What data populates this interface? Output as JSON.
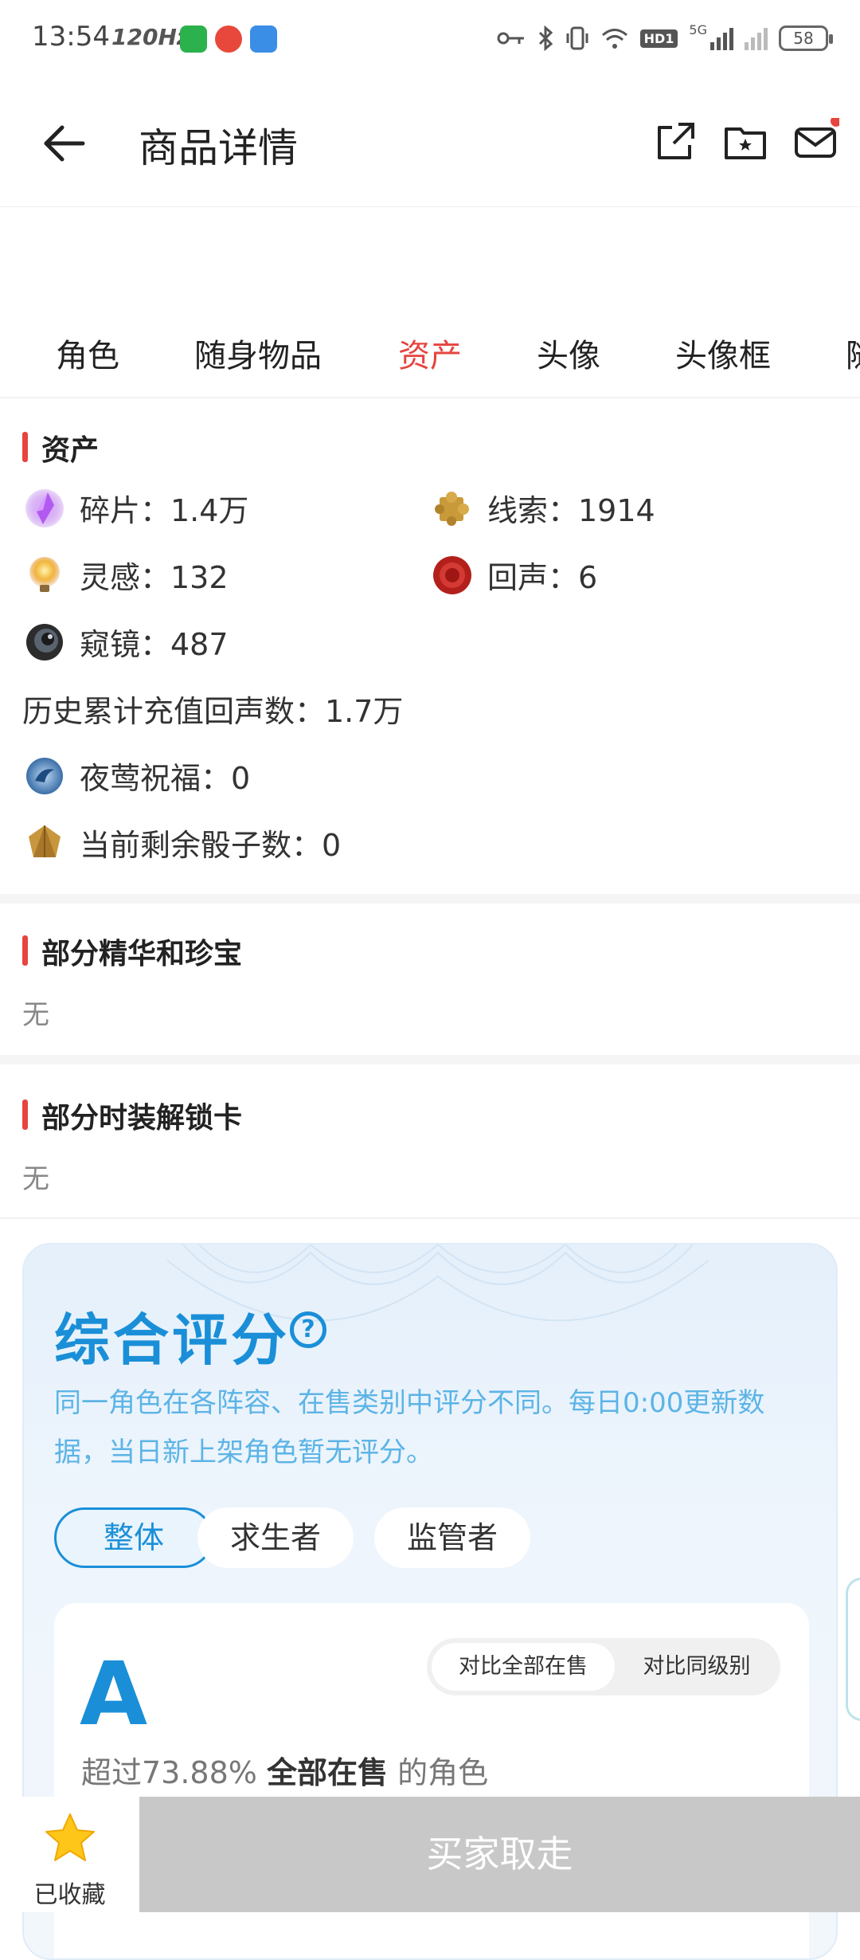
{
  "status_bar": {
    "time": "13:54",
    "refresh_rate": "120Hz",
    "network": "5G",
    "hd_label": "HD1",
    "battery": "58"
  },
  "header": {
    "title": "商品详情"
  },
  "tabs": [
    {
      "label": "角色",
      "active": false
    },
    {
      "label": "随身物品",
      "active": false
    },
    {
      "label": "资产",
      "active": true
    },
    {
      "label": "头像",
      "active": false
    },
    {
      "label": "头像框",
      "active": false
    },
    {
      "label": "随",
      "active": false
    }
  ],
  "assets": {
    "section_title": "资产",
    "items": [
      {
        "label": "碎片：1.4万",
        "icon": "fragment-icon"
      },
      {
        "label": "线索：1914",
        "icon": "clue-icon"
      },
      {
        "label": "灵感：132",
        "icon": "inspiration-icon"
      },
      {
        "label": "回声：6",
        "icon": "echo-icon"
      },
      {
        "label": "窥镜：487",
        "icon": "lens-icon"
      }
    ],
    "history_recharge": "历史累计充值回声数：1.7万",
    "nightingale": "夜莺祝福：0",
    "dice": "当前剩余骰子数：0"
  },
  "essence_section": {
    "title": "部分精华和珍宝",
    "value": "无"
  },
  "costume_section": {
    "title": "部分时装解锁卡",
    "value": "无"
  },
  "score": {
    "title": "综合评分",
    "help_symbol": "?",
    "description": "同一角色在各阵容、在售类别中评分不同。每日0:00更新数据，当日新上架角色暂无评分。",
    "filters": [
      "整体",
      "求生者",
      "监管者"
    ],
    "active_filter": "整体",
    "grade": "A",
    "compare_options": [
      "对比全部在售",
      "对比同级别"
    ],
    "exceed_prefix": "超过73.88%",
    "exceed_bold": "全部在售",
    "exceed_suffix": "的角色"
  },
  "bottom_bar": {
    "favorite_label": "已收藏",
    "buy_label": "买家取走"
  },
  "colors": {
    "accent_red": "#e6453f",
    "accent_blue": "#1a8fd8",
    "disabled_gray": "#c8c8c8",
    "star_yellow": "#ffc61a"
  }
}
